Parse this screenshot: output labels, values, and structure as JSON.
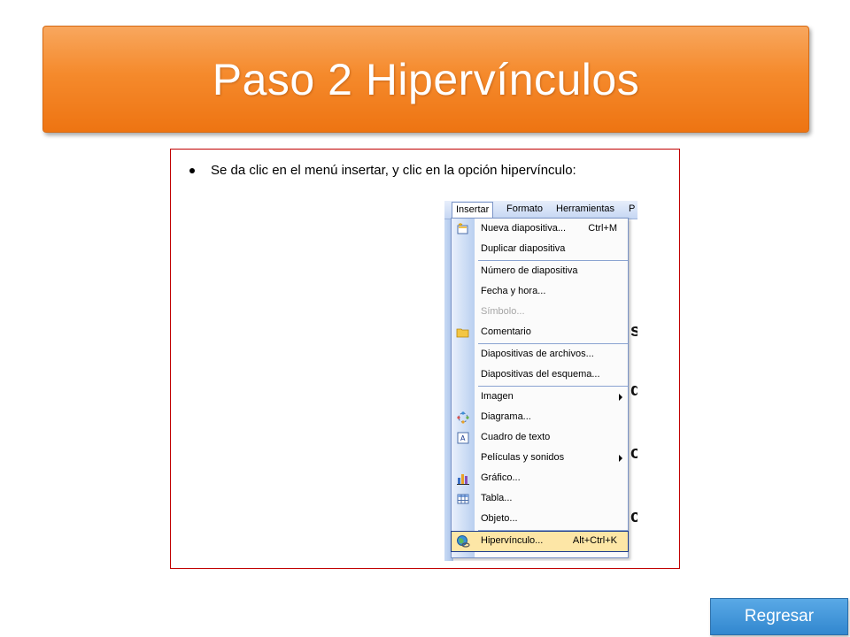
{
  "slide": {
    "title": "Paso 2 Hipervínculos",
    "bullet": "Se da clic en el menú insertar, y clic en la opción hipervínculo:",
    "back_button": "Regresar"
  },
  "menubar": {
    "items": [
      "Insertar",
      "Formato",
      "Herramientas",
      "P"
    ]
  },
  "menu": {
    "items": [
      {
        "label": "Nueva diapositiva...",
        "shortcut": "Ctrl+M",
        "icon": "new-slide-icon"
      },
      {
        "label": "Duplicar diapositiva"
      },
      {
        "label": "Número de diapositiva"
      },
      {
        "label": "Fecha y hora..."
      },
      {
        "label": "Símbolo...",
        "disabled": true
      },
      {
        "label": "Comentario",
        "icon": "comment-folder-icon"
      },
      {
        "label": "Diapositivas de archivos..."
      },
      {
        "label": "Diapositivas del esquema..."
      },
      {
        "label": "Imagen",
        "submenu": true
      },
      {
        "label": "Diagrama...",
        "icon": "diagram-icon"
      },
      {
        "label": "Cuadro de texto",
        "icon": "textbox-icon"
      },
      {
        "label": "Películas y sonidos",
        "submenu": true
      },
      {
        "label": "Gráfico...",
        "icon": "chart-icon"
      },
      {
        "label": "Tabla...",
        "icon": "table-icon"
      },
      {
        "label": "Objeto..."
      },
      {
        "label": "Hipervínculo...",
        "shortcut": "Alt+Ctrl+K",
        "icon": "hyperlink-globe-icon",
        "highlighted": true
      }
    ]
  },
  "background_glimpse": [
    "s",
    "d",
    "o",
    "c"
  ],
  "colors": {
    "title_banner": "#f58a2c",
    "frame_border": "#c00000",
    "back_button": "#3287cf",
    "menu_highlight": "#fde6a6"
  }
}
